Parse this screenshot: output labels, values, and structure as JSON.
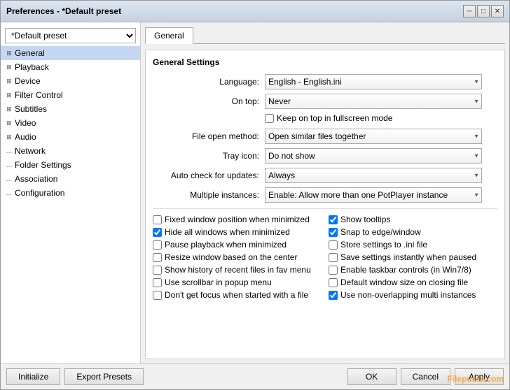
{
  "window": {
    "title": "Preferences - *Default preset"
  },
  "sidebar": {
    "preset_label": "*Default preset",
    "items": [
      {
        "label": "General",
        "indent": 0,
        "has_children": true
      },
      {
        "label": "Playback",
        "indent": 0,
        "has_children": true
      },
      {
        "label": "Device",
        "indent": 0,
        "has_children": true
      },
      {
        "label": "Filter Control",
        "indent": 0,
        "has_children": true
      },
      {
        "label": "Subtitles",
        "indent": 0,
        "has_children": true
      },
      {
        "label": "Video",
        "indent": 0,
        "has_children": true
      },
      {
        "label": "Audio",
        "indent": 0,
        "has_children": true
      },
      {
        "label": "Network",
        "indent": 0,
        "has_children": false
      },
      {
        "label": "Folder Settings",
        "indent": 0,
        "has_children": false
      },
      {
        "label": "Association",
        "indent": 0,
        "has_children": false
      },
      {
        "label": "Configuration",
        "indent": 0,
        "has_children": false
      }
    ]
  },
  "tabs": [
    {
      "label": "General",
      "active": true
    }
  ],
  "general_settings": {
    "section_title": "General Settings",
    "language_label": "Language:",
    "language_value": "English - English.ini",
    "on_top_label": "On top:",
    "on_top_value": "Never",
    "keep_on_top_label": "Keep on top in fullscreen mode",
    "file_open_label": "File open method:",
    "file_open_value": "Open similar files together",
    "tray_icon_label": "Tray icon:",
    "tray_icon_value": "Do not show",
    "auto_check_label": "Auto check for updates:",
    "auto_check_value": "Always",
    "multiple_instances_label": "Multiple instances:",
    "multiple_instances_value": "Enable: Allow more than one PotPlayer instance",
    "checkboxes_left": [
      {
        "label": "Fixed window position when minimized",
        "checked": false
      },
      {
        "label": "Hide all windows when minimized",
        "checked": true
      },
      {
        "label": "Pause playback when minimized",
        "checked": false
      },
      {
        "label": "Resize window based on the center",
        "checked": false
      },
      {
        "label": "Show history of recent files in fav menu",
        "checked": false
      },
      {
        "label": "Use scrollbar in popup menu",
        "checked": false
      },
      {
        "label": "Don't get focus when started with a file",
        "checked": false
      }
    ],
    "checkboxes_right": [
      {
        "label": "Show tooltips",
        "checked": true
      },
      {
        "label": "Snap to edge/window",
        "checked": true
      },
      {
        "label": "Store settings to .ini file",
        "checked": false
      },
      {
        "label": "Save settings instantly when paused",
        "checked": false
      },
      {
        "label": "Enable taskbar controls (in Win7/8)",
        "checked": false
      },
      {
        "label": "Default window size on closing file",
        "checked": false
      },
      {
        "label": "Use non-overlapping multi instances",
        "checked": true
      }
    ]
  },
  "bottom": {
    "initialize_label": "Initialize",
    "export_label": "Export Presets",
    "ok_label": "OK",
    "cancel_label": "Cancel",
    "apply_label": "Apply"
  },
  "watermark": "Filepuma.com"
}
